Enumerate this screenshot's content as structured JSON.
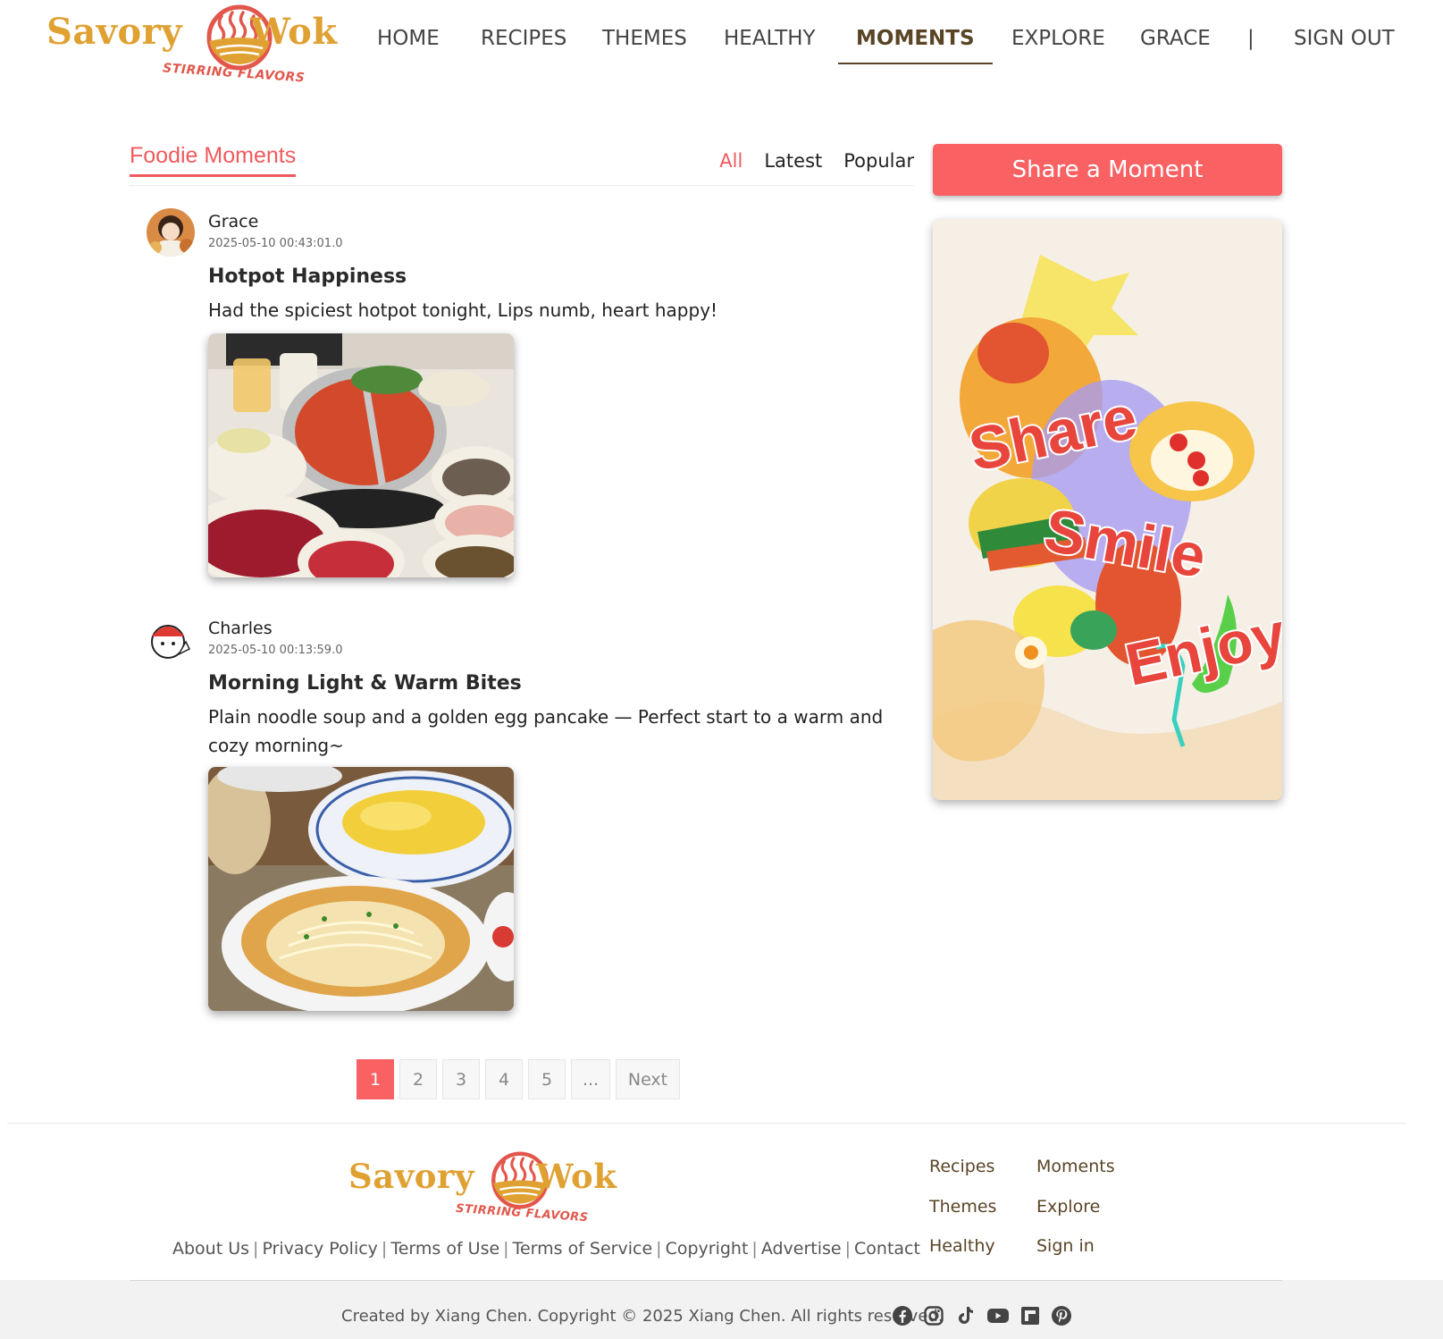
{
  "brand": {
    "word1": "Savory",
    "word2": "Wok",
    "tagline": "STIRRING FLAVORS"
  },
  "colors": {
    "accent": "#f96163",
    "brand_gold": "#e0a133",
    "brand_brown": "#5a4426"
  },
  "nav": {
    "items": [
      "HOME",
      "RECIPES",
      "THEMES",
      "HEALTHY",
      "MOMENTS",
      "EXPLORE",
      "GRACE"
    ],
    "active": "MOMENTS",
    "separator": "|",
    "signout": "SIGN OUT"
  },
  "feed": {
    "title": "Foodie Moments",
    "filters": [
      "All",
      "Latest",
      "Popular"
    ],
    "active_filter": "All"
  },
  "posts": [
    {
      "user": "Grace",
      "time": "2025-05-10 00:43:01.0",
      "title": "Hotpot Happiness",
      "body": "Had the spiciest hotpot tonight, Lips numb, heart happy!"
    },
    {
      "user": "Charles",
      "time": "2025-05-10 00:13:59.0",
      "title": "Morning Light & Warm Bites",
      "body": "Plain noodle soup and a golden egg pancake — Perfect start to a warm and cozy morning~"
    }
  ],
  "pagination": {
    "pages": [
      "1",
      "2",
      "3",
      "4",
      "5",
      "..."
    ],
    "current": "1",
    "next": "Next"
  },
  "sidebar": {
    "share_button": "Share a Moment",
    "poster_words": [
      "Share",
      "Smile",
      "Enjoy"
    ]
  },
  "footer": {
    "links": [
      "About Us",
      "Privacy Policy",
      "Terms of Use",
      "Terms of Service",
      "Copyright",
      "Advertise",
      "Contact"
    ],
    "separator": "|",
    "nav_col1": [
      "Recipes",
      "Themes",
      "Healthy"
    ],
    "nav_col2": [
      "Moments",
      "Explore",
      "Sign in"
    ],
    "copyright": "Created by Xiang Chen. Copyright © 2025 Xiang Chen. All rights reserved.",
    "social_icons": [
      "facebook-icon",
      "instagram-icon",
      "tiktok-icon",
      "youtube-icon",
      "flipboard-icon",
      "pinterest-icon"
    ]
  }
}
